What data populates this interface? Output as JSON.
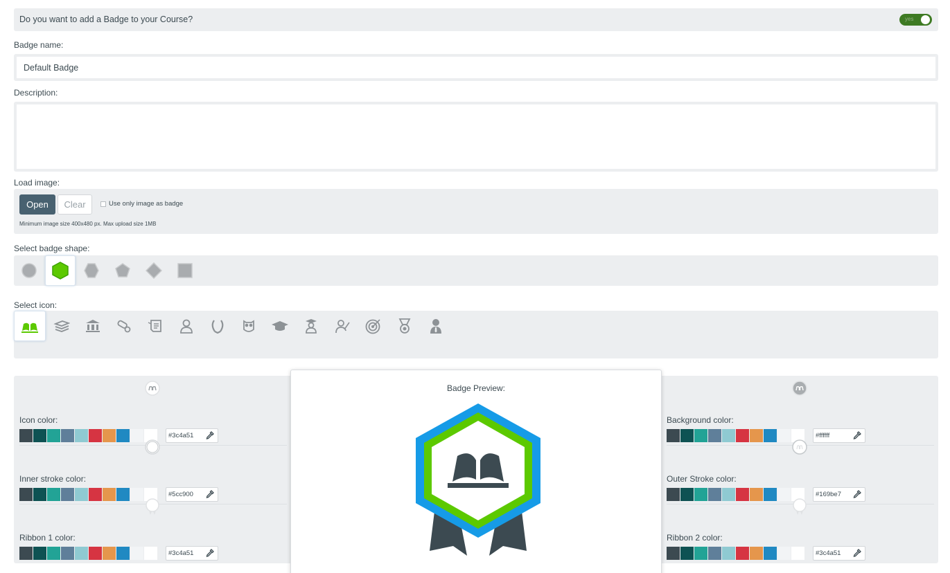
{
  "question": {
    "text": "Do you want to add a Badge to your Course?",
    "toggle_label": "yes",
    "toggle_on": true
  },
  "badge_name": {
    "label": "Badge name:",
    "value": "Default Badge"
  },
  "description": {
    "label": "Description:",
    "value": ""
  },
  "load_image": {
    "label": "Load image:",
    "open_label": "Open",
    "clear_label": "Clear",
    "only_image_label": "Use only image as badge",
    "only_image_checked": false,
    "hint": "Minimum image size 400x480 px. Max upload size 1MB"
  },
  "shape": {
    "label": "Select badge shape:",
    "options": [
      "circle-icon",
      "hexagon-icon",
      "hexagon-flat-icon",
      "pentagon-icon",
      "diamond-icon",
      "square-icon"
    ],
    "selected": 1
  },
  "icon": {
    "label": "Select icon:",
    "options": [
      "open-book-icon",
      "book-stack-icon",
      "institution-icon",
      "diploma-icon",
      "certificate-icon",
      "student-icon",
      "laurel-icon",
      "owl-icon",
      "graduation-cap-icon",
      "graduate-icon",
      "teacher-icon",
      "target-icon",
      "medal-icon",
      "person-tie-icon"
    ],
    "selected": 0
  },
  "palette": [
    "#3c4a51",
    "#0e5253",
    "#22a396",
    "#5f7f9a",
    "#8fcad2",
    "#d63442",
    "#e5964c",
    "#2089c2",
    "#f2f4f6",
    "#ffffff"
  ],
  "colors": {
    "icon": {
      "label": "Icon color:",
      "value": "#3c4a51"
    },
    "inner_stroke": {
      "label": "Inner stroke color:",
      "value": "#5cc900"
    },
    "ribbon1": {
      "label": "Ribbon 1 color:",
      "value": "#3c4a51"
    },
    "background": {
      "label": "Background color:",
      "value": "#ffffff"
    },
    "outer_stroke": {
      "label": "Outer Stroke color:",
      "value": "#169be7"
    },
    "ribbon2": {
      "label": "Ribbon 2 color:",
      "value": "#3c4a51"
    }
  },
  "preview": {
    "title": "Badge Preview:"
  },
  "accent": {
    "selected_green": "#5cc900",
    "dark_button": "#486170",
    "toggle_green": "#3e7a23"
  }
}
